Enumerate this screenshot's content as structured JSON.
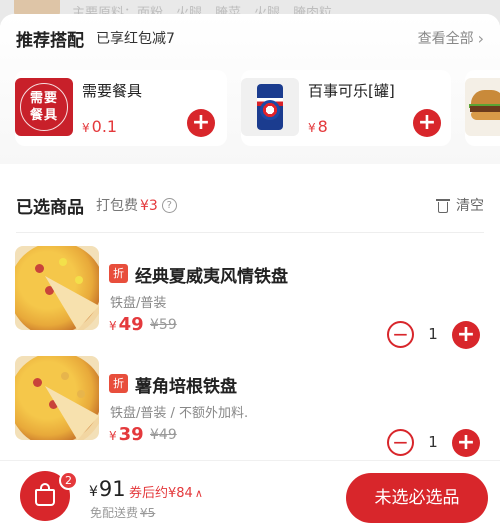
{
  "background": {
    "text": "主要原料：面粉，火腿，腌菜，火腿，腌肉粒…"
  },
  "recommend": {
    "title": "推荐搭配",
    "subtitle": "已享红包减7",
    "more_label": "查看全部",
    "items": [
      {
        "name": "需要餐具",
        "price": "0.1",
        "currency": "¥",
        "image_text": [
          "需要",
          "餐具"
        ]
      },
      {
        "name": "百事可乐[罐]",
        "price": "8",
        "currency": "¥"
      },
      {
        "name": "",
        "price": "",
        "currency": ""
      }
    ]
  },
  "selected": {
    "title": "已选商品",
    "packing_fee_label": "打包费",
    "packing_fee": "¥3",
    "clear_label": "清空",
    "items": [
      {
        "tag": "折",
        "name": "经典夏威夷风情铁盘",
        "spec": "铁盘/普装",
        "price": "49",
        "original_price": "¥59",
        "currency": "¥",
        "quantity": "1"
      },
      {
        "tag": "折",
        "name": "薯角培根铁盘",
        "spec": "铁盘/普装 / 不额外加料.",
        "price": "39",
        "original_price": "¥49",
        "currency": "¥",
        "quantity": "1"
      }
    ]
  },
  "bottom": {
    "cart_count": "2",
    "total": "91",
    "currency": "¥",
    "after_coupon": "券后约¥84",
    "shipping_label": "免配送费",
    "shipping_original": "¥5",
    "cta_label": "未选必选品"
  },
  "colors": {
    "accent": "#d8262b",
    "price": "#e4393c"
  }
}
